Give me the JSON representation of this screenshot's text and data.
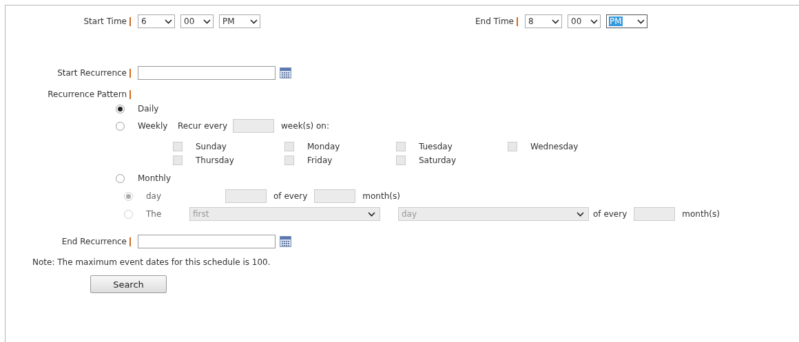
{
  "start_time": {
    "label": "Start Time",
    "required": true,
    "selects": [
      {
        "value": "6",
        "focused": false
      },
      {
        "value": "00",
        "focused": false
      },
      {
        "value": "PM",
        "focused": false
      }
    ]
  },
  "end_time": {
    "label": "End Time",
    "required": true,
    "selects": [
      {
        "value": "8",
        "focused": false
      },
      {
        "value": "00",
        "focused": false
      },
      {
        "value": "PM",
        "focused": true
      }
    ]
  },
  "start_recurrence": {
    "label": "Start Recurrence",
    "required": true
  },
  "recurrence_pattern": {
    "label": "Recurrence Pattern",
    "required": true,
    "options": [
      {
        "label": "Daily",
        "selected": true
      },
      {
        "label": "Weekly",
        "selected": false
      },
      {
        "label": "Monthly",
        "selected": false
      }
    ]
  },
  "weekly": {
    "disabled": true,
    "recur_every": "Recur every",
    "unit": "week(s) on:",
    "days": [
      {
        "label": "Sunday",
        "checked": false
      },
      {
        "label": "Monday",
        "checked": false
      },
      {
        "label": "Tuesday",
        "checked": false
      },
      {
        "label": "Wednesday",
        "checked": false
      },
      {
        "label": "Thursday",
        "checked": false
      },
      {
        "label": "Friday",
        "checked": false
      },
      {
        "label": "Saturday",
        "checked": false
      }
    ]
  },
  "monthly": {
    "disabled": true,
    "options": [
      {
        "kind": "day",
        "label": "day",
        "selected": true,
        "text_1": "of every",
        "text_2": "month(s)"
      },
      {
        "kind": "the",
        "label": "The",
        "selected": false,
        "ordinal": "first",
        "weekday": "day",
        "text_1": "of every",
        "text_2": "month(s)"
      }
    ]
  },
  "end_recurrence": {
    "label": "End Recurrence",
    "required": true
  },
  "note": "Note: The maximum event dates for this schedule is 100.",
  "search_button": "Search"
}
